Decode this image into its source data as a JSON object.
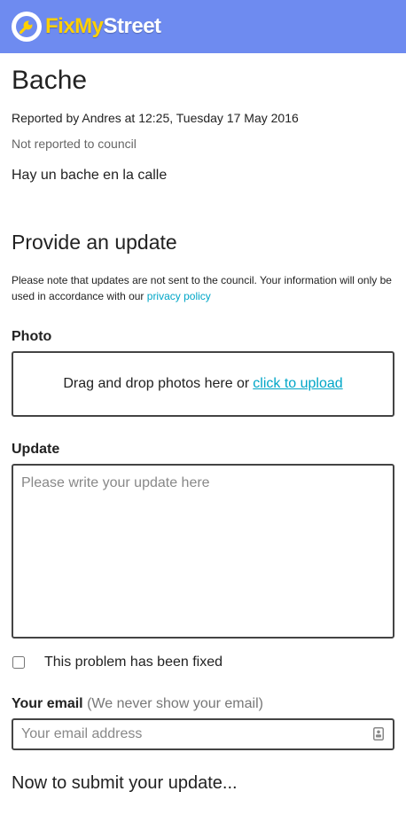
{
  "header": {
    "logo_part1": "FixMy",
    "logo_part2": "Street",
    "icon": "wrench-icon",
    "background": "#6e8bf0"
  },
  "report": {
    "title": "Bache",
    "meta": "Reported by Andres at 12:25, Tuesday 17 May 2016",
    "status": "Not reported to council",
    "detail": "Hay un bache en la calle"
  },
  "update_form": {
    "heading": "Provide an update",
    "note": "Please note that updates are not sent to the council. Your information will only be used in accordance with our",
    "privacy_link": "privacy policy",
    "photo_label": "Photo",
    "dropzone_text": "Drag and drop photos here or",
    "upload_link": "click to upload",
    "update_label": "Update",
    "update_placeholder": "Please write your update here",
    "fixed_label": "This problem has been fixed",
    "fixed_checked": false,
    "email_label": "Your email",
    "email_hint": "(We never show your email)",
    "email_placeholder": "Your email address",
    "submit_heading": "Now to submit your update..."
  },
  "colors": {
    "link": "#00a6c7",
    "logo_yellow": "#ffd000"
  }
}
